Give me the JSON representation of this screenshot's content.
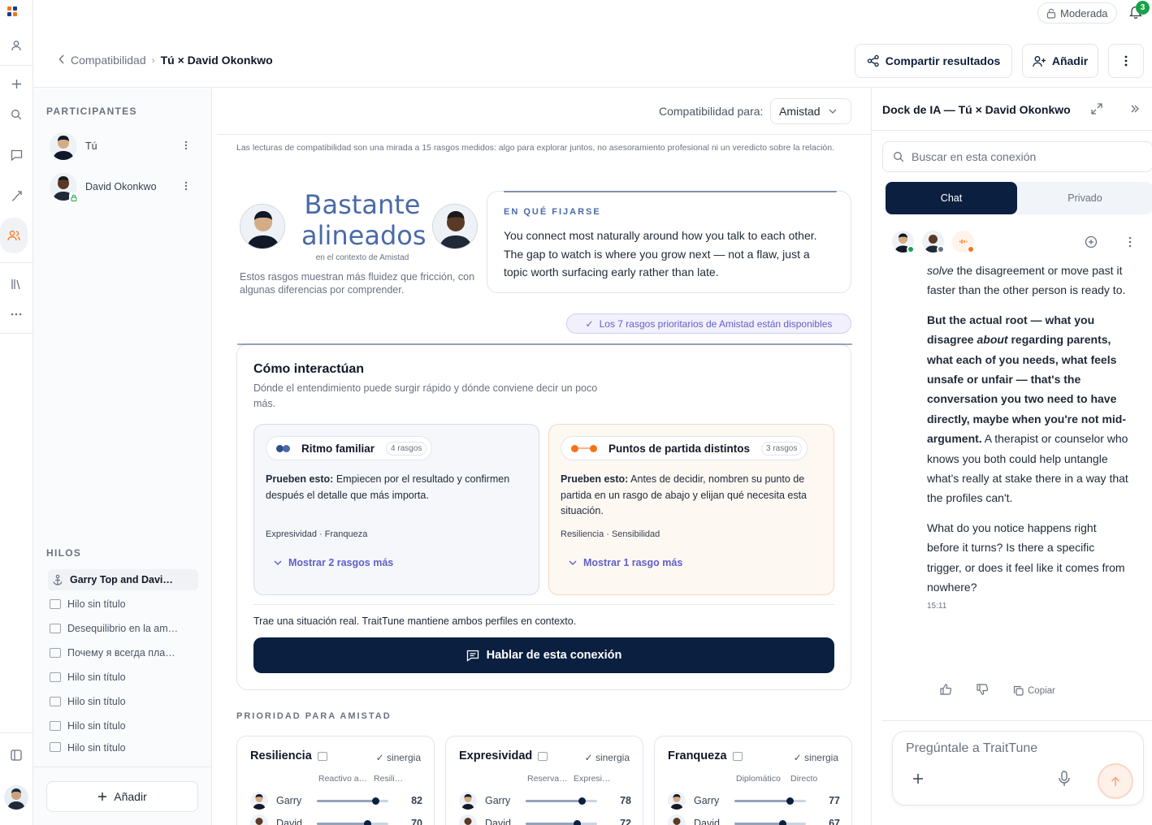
{
  "app": {
    "mode_label": "Moderada",
    "notifications_count": "3",
    "brand_colors": {
      "navy": "#0b2040",
      "accent_blue": "#4a6aa8",
      "orange": "#f97316",
      "purple": "#6560c8"
    }
  },
  "rail": {
    "icons": [
      "logo-icon",
      "user-icon",
      "plus-icon",
      "search-icon",
      "chat-icon",
      "path-icon",
      "people-icon",
      "library-icon",
      "more-icon",
      "panel-icon",
      "avatar"
    ]
  },
  "header": {
    "breadcrumb_parent": "Compatibilidad",
    "breadcrumb_current": "Tú × David Okonkwo",
    "share_label": "Compartir resultados",
    "add_label": "Añadir"
  },
  "participants": {
    "title": "PARTICIPANTES",
    "items": [
      {
        "name": "Tú"
      },
      {
        "name": "David Okonkwo"
      }
    ]
  },
  "threads": {
    "title": "HILOS",
    "items": [
      {
        "label": "Garry Top and Davi…",
        "active": true
      },
      {
        "label": "Hilo sin título"
      },
      {
        "label": "Desequilibrio en la am…"
      },
      {
        "label": "Почему я всегда пла…"
      },
      {
        "label": "Hilo sin título"
      },
      {
        "label": "Hilo sin título"
      },
      {
        "label": "Hilo sin título"
      },
      {
        "label": "Hilo sin título"
      }
    ],
    "add_label": "Añadir"
  },
  "main": {
    "compat_for_label": "Compatibilidad para:",
    "compat_for_value": "Amistad",
    "disclaimer": "Las lecturas de compatibilidad son una mirada a 15 rasgos medidos: algo para explorar juntos, no asesoramiento profesional ni un veredicto sobre la relación.",
    "verdict_line1": "Bastante",
    "verdict_line2": "alineados",
    "verdict_context": "en el contexto de Amistad",
    "verdict_sub": "Estos rasgos muestran más fluidez que fricción, con algunas diferencias por comprender.",
    "focus": {
      "label": "EN QUÉ FIJARSE",
      "text": "You connect most naturally around how you talk to each other. The gap to watch is where you grow next — not a flaw, just a topic worth surfacing early rather than late."
    },
    "available_pill": "Los 7 rasgos prioritarios de Amistad están disponibles",
    "interact": {
      "title": "Cómo interactúan",
      "subtitle": "Dónde el entendimiento puede surgir rápido y dónde conviene decir un poco más.",
      "cards": [
        {
          "name": "Ritmo familiar",
          "count": "4 rasgos",
          "try_label": "Prueben esto:",
          "try_text": "Empiecen por el resultado y confirmen después el detalle que más importa.",
          "traits": "Expresividad · Franqueza",
          "more": "Mostrar 2 rasgos más"
        },
        {
          "name": "Puntos de partida distintos",
          "count": "3 rasgos",
          "try_label": "Prueben esto:",
          "try_text": "Antes de decidir, nombren su punto de partida en un rasgo de abajo y elijan qué necesita esta situación.",
          "traits": "Resiliencia · Sensibilidad",
          "more": "Mostrar 1 rasgo más"
        }
      ],
      "bring_text": "Trae una situación real. TraitTune mantiene ambos perfiles en contexto.",
      "talk_button": "Hablar de esta conexión"
    },
    "priority": {
      "label": "PRIORIDAD PARA AMISTAD",
      "cards": [
        {
          "trait": "Resiliencia",
          "status": "✓ sinergia",
          "left_pole": "Reactivo a…",
          "right_pole": "Resili…",
          "person1": "Garry",
          "value1": "82",
          "person2": "David",
          "value2": "70"
        },
        {
          "trait": "Expresividad",
          "status": "✓ sinergia",
          "left_pole": "Reserva…",
          "right_pole": "Expresi…",
          "person1": "Garry",
          "value1": "78",
          "person2": "David",
          "value2": "72"
        },
        {
          "trait": "Franqueza",
          "status": "✓ sinergia",
          "left_pole": "Diplomático",
          "right_pole": "Directo",
          "person1": "Garry",
          "value1": "77",
          "person2": "David",
          "value2": "67"
        }
      ]
    }
  },
  "dock": {
    "title": "Dock de IA — Tú × David Okonkwo",
    "search_placeholder": "Buscar en esta conexión",
    "tabs": [
      "Chat",
      "Privado"
    ],
    "message": {
      "p1_em": "solve",
      "p1_rest": " the disagreement or move past it faster than the other person is ready to.",
      "p2_b1": "But the actual root — what you disagree ",
      "p2_em": "about",
      "p2_b2": " regarding parents, what each of you needs, what feels unsafe or unfair — that's the conversation you two need to have directly, maybe when you're not mid-argument.",
      "p2_rest": " A therapist or counselor who knows you both could help untangle what's really at stake there in a way that the profiles can't.",
      "p3": "What do you notice happens right before it turns? Is there a specific trigger, or does it feel like it comes from nowhere?",
      "time": "15:11"
    },
    "copy_label": "Copiar",
    "composer_placeholder": "Pregúntale a TraitTune"
  }
}
